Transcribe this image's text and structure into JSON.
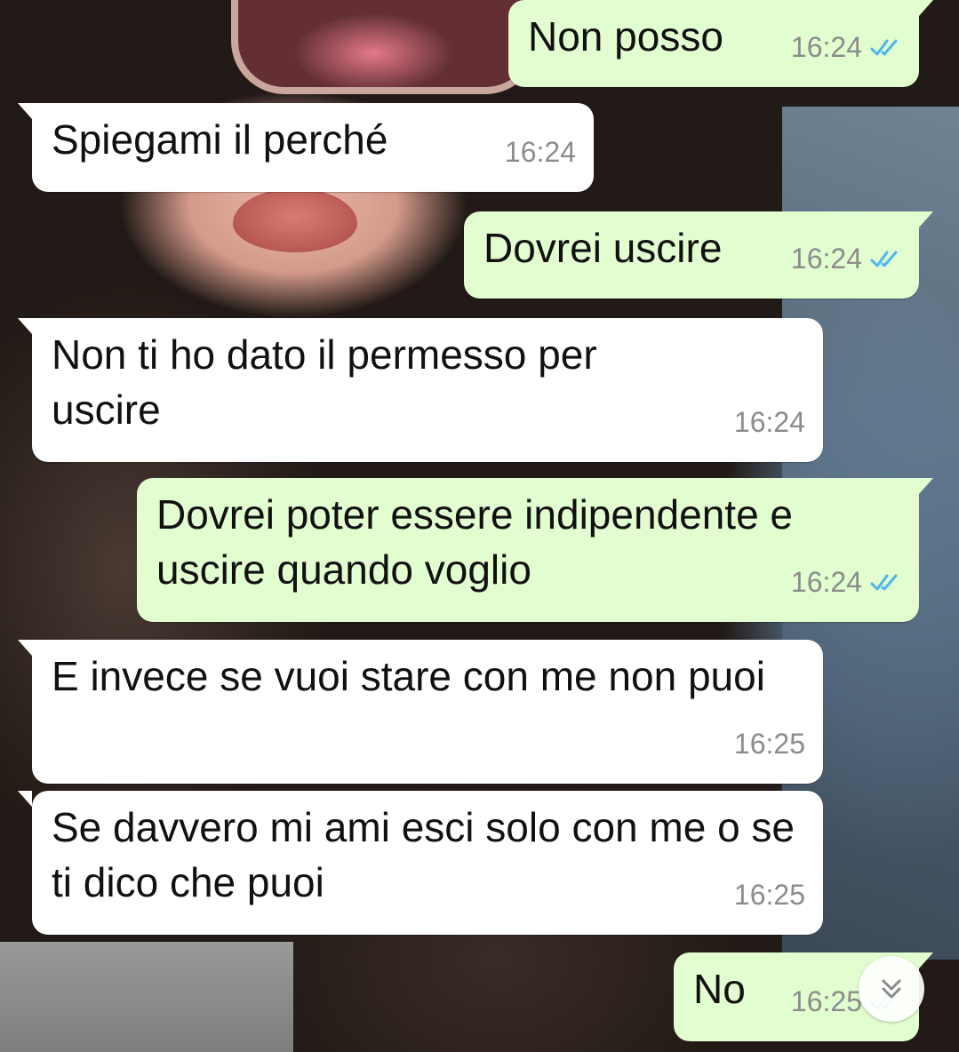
{
  "messages": [
    {
      "text": "Non posso",
      "time": "16:24",
      "direction": "outgoing",
      "read": true
    },
    {
      "text": "Spiegami il perché",
      "time": "16:24",
      "direction": "incoming"
    },
    {
      "text": "Dovrei uscire",
      "time": "16:24",
      "direction": "outgoing",
      "read": true
    },
    {
      "text": "Non ti ho dato il permesso per uscire",
      "time": "16:24",
      "direction": "incoming"
    },
    {
      "text": "Dovrei poter essere indipendente e uscire quando voglio",
      "time": "16:24",
      "direction": "outgoing",
      "read": true
    },
    {
      "text": "E invece se vuoi stare con me non puoi",
      "time": "16:25",
      "direction": "incoming"
    },
    {
      "text": "Se davvero mi ami esci solo con me o se ti dico che puoi",
      "time": "16:25",
      "direction": "incoming"
    },
    {
      "text": "No",
      "time": "16:25",
      "direction": "outgoing",
      "read": true
    }
  ],
  "icons": {
    "read_receipt": "double-check-icon",
    "scroll_down": "double-chevron-down-icon"
  },
  "colors": {
    "incoming_bubble": "#ffffff",
    "outgoing_bubble": "#e2fdcf",
    "read_ticks": "#4fb6ec",
    "timestamp": "#8c8c8c"
  }
}
